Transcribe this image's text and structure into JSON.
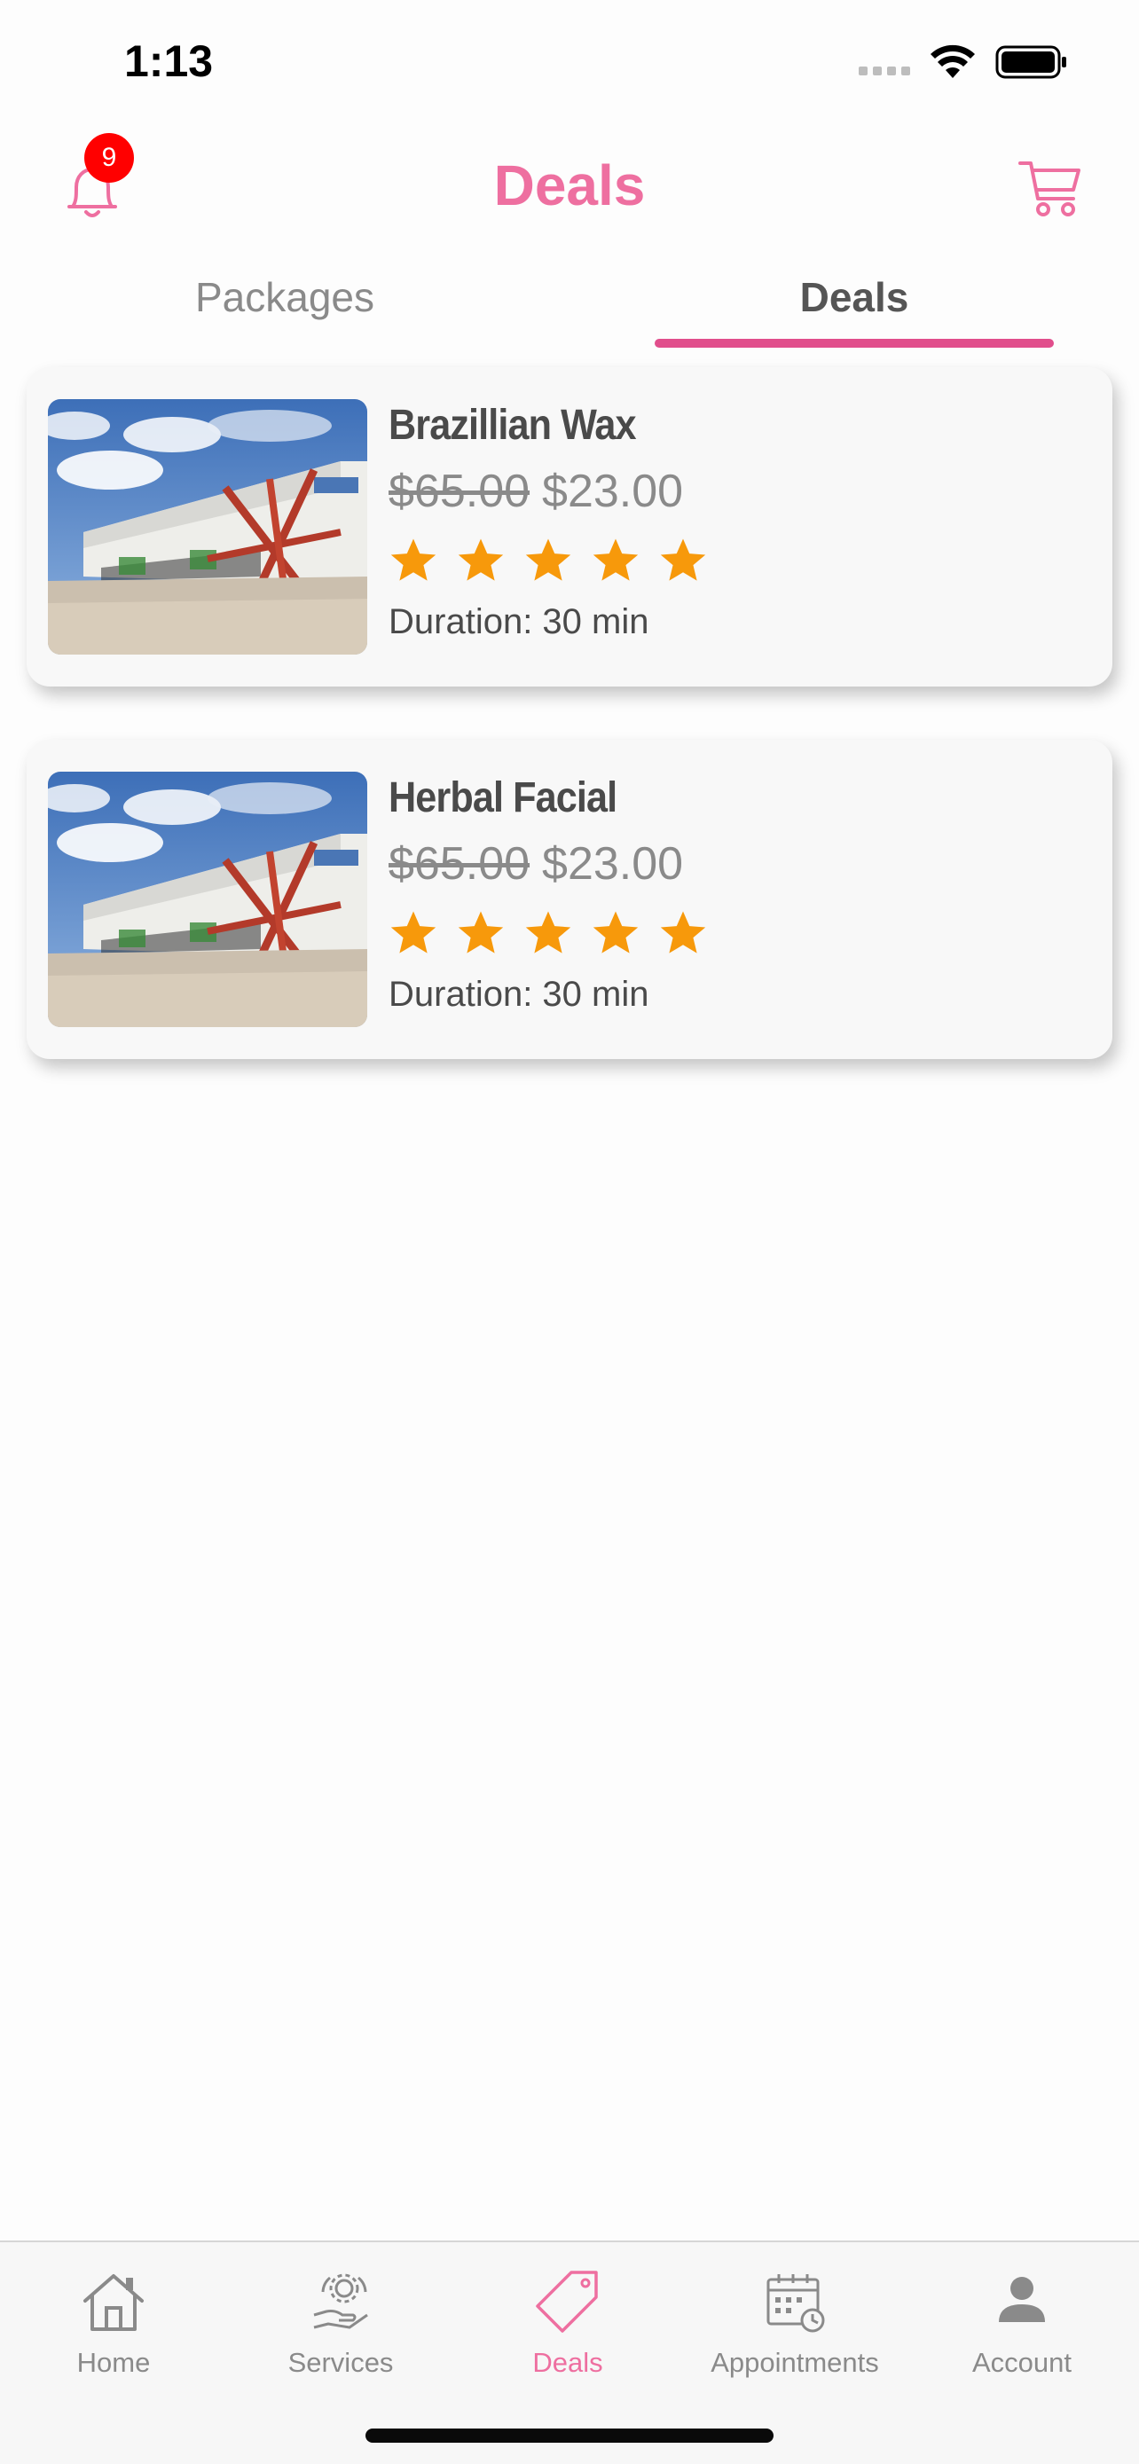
{
  "status_bar": {
    "time": "1:13"
  },
  "header": {
    "title": "Deals",
    "notification_count": "9",
    "bell_icon": "bell-icon",
    "cart_icon": "cart-icon",
    "accent_color": "#ee6fa0"
  },
  "tabs": [
    {
      "label": "Packages",
      "active": false
    },
    {
      "label": "Deals",
      "active": true
    }
  ],
  "deals": [
    {
      "title": "Brazillian Wax",
      "old_price": "$65.00",
      "new_price": "$23.00",
      "rating": 5,
      "duration": "Duration: 30 min"
    },
    {
      "title": "Herbal Facial",
      "old_price": "$65.00",
      "new_price": "$23.00",
      "rating": 5,
      "duration": "Duration: 30 min"
    }
  ],
  "tab_bar": [
    {
      "label": "Home",
      "icon": "home-icon",
      "active": false
    },
    {
      "label": "Services",
      "icon": "services-icon",
      "active": false
    },
    {
      "label": "Deals",
      "icon": "tag-icon",
      "active": true
    },
    {
      "label": "Appointments",
      "icon": "calendar-icon",
      "active": false
    },
    {
      "label": "Account",
      "icon": "person-icon",
      "active": false
    }
  ],
  "colors": {
    "accent": "#ee6fa0",
    "tab_underline": "#e14e8c",
    "badge": "#ff0000",
    "star": "#f7990b"
  }
}
